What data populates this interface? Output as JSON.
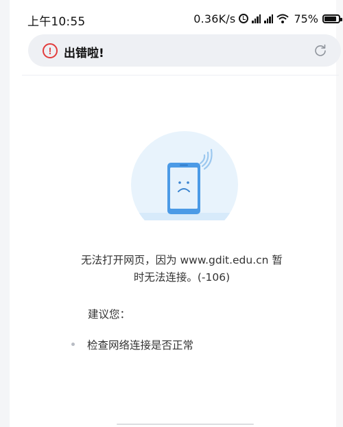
{
  "status_bar": {
    "time": "上午10:55",
    "net_speed": "0.36K/s",
    "battery_percent": "75%",
    "icons": [
      "alarm-icon",
      "signal-icon",
      "signal-icon",
      "wifi-icon",
      "battery-icon"
    ]
  },
  "address_bar": {
    "icon": "error-icon",
    "icon_glyph": "!",
    "title": "出错啦!",
    "action_icon": "reload-icon"
  },
  "error_page": {
    "illustration": "sad-phone-icon",
    "message_line1": "无法打开网页，因为 www.gdit.edu.cn 暂",
    "message_line2": "时无法连接。(-106)",
    "suggestion_label": "建议您：",
    "suggestions": [
      "检查网络连接是否正常"
    ]
  },
  "colors": {
    "error_red": "#e23b3b",
    "phone_blue": "#4b9ae6",
    "circle_bg": "#e8f3fc",
    "address_bg": "#eef0f4"
  }
}
